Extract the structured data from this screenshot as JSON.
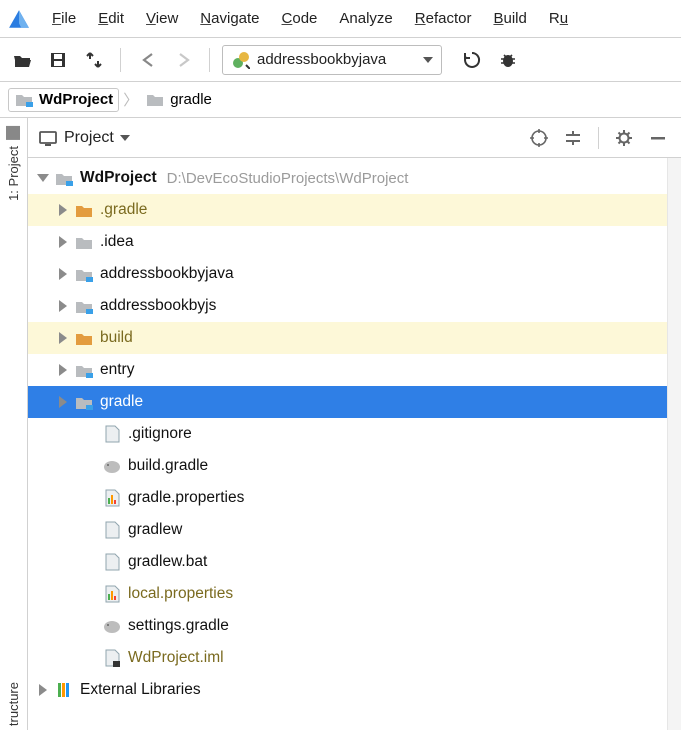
{
  "menu": {
    "items": [
      "File",
      "Edit",
      "View",
      "Navigate",
      "Code",
      "Analyze",
      "Refactor",
      "Build",
      "Ru"
    ]
  },
  "toolbar": {
    "run_config_label": "addressbookbyjava"
  },
  "breadcrumb": {
    "root": "WdProject",
    "child": "gradle"
  },
  "panel": {
    "title": "Project"
  },
  "left_tabs": {
    "top": "1: Project",
    "bottom": "tructure"
  },
  "tree": {
    "root": {
      "name": "WdProject",
      "path": "D:\\DevEcoStudioProjects\\WdProject"
    },
    "children": [
      {
        "name": ".gradle",
        "type": "folder",
        "style": "orange",
        "hl": "yellow"
      },
      {
        "name": ".idea",
        "type": "folder",
        "style": "gray"
      },
      {
        "name": "addressbookbyjava",
        "type": "folder",
        "style": "module"
      },
      {
        "name": "addressbookbyjs",
        "type": "folder",
        "style": "module"
      },
      {
        "name": "build",
        "type": "folder",
        "style": "orange",
        "hl": "yellow"
      },
      {
        "name": "entry",
        "type": "folder",
        "style": "module"
      },
      {
        "name": "gradle",
        "type": "folder",
        "style": "module",
        "hl": "blue"
      }
    ],
    "files": [
      {
        "name": ".gitignore",
        "icon": "file-dot"
      },
      {
        "name": "build.gradle",
        "icon": "gradle"
      },
      {
        "name": "gradle.properties",
        "icon": "props"
      },
      {
        "name": "gradlew",
        "icon": "text"
      },
      {
        "name": "gradlew.bat",
        "icon": "text"
      },
      {
        "name": "local.properties",
        "icon": "props",
        "muted": true
      },
      {
        "name": "settings.gradle",
        "icon": "gradle"
      },
      {
        "name": "WdProject.iml",
        "icon": "iml",
        "muted": true
      }
    ],
    "tail": {
      "name": "External Libraries"
    }
  }
}
